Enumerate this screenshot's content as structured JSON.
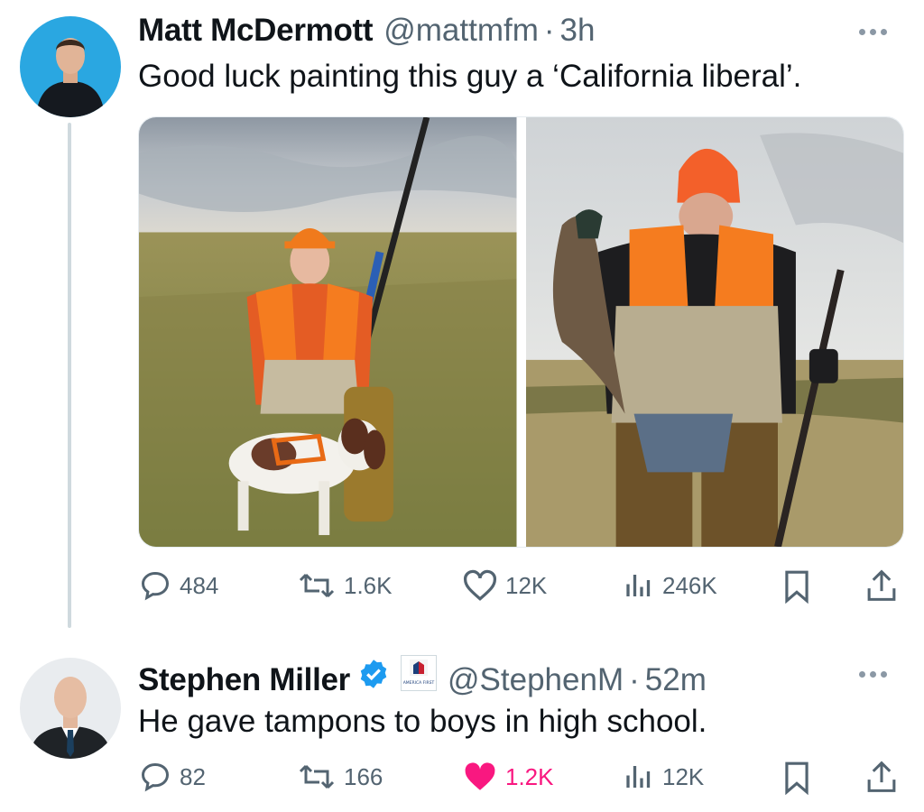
{
  "tweet1": {
    "name": "Matt McDermott",
    "handle": "@mattmfm",
    "separator": "·",
    "time": "3h",
    "text": "Good luck painting this guy a ‘California liberal’.",
    "stats": {
      "replies": "484",
      "reposts": "1.6K",
      "likes": "12K",
      "views": "246K"
    },
    "liked": false
  },
  "tweet2": {
    "name": "Stephen Miller",
    "badge_text": "AMERICA FIRST",
    "handle": "@StephenM",
    "separator": "·",
    "time": "52m",
    "text": "He gave tampons to boys in high school.",
    "stats": {
      "replies": "82",
      "reposts": "166",
      "likes": "1.2K",
      "views": "12K"
    },
    "liked": true
  },
  "colors": {
    "text_primary": "#0f1419",
    "text_secondary": "#536471",
    "like_active": "#f91880",
    "verified_blue": "#1d9bf0",
    "thread_line": "#cfd9de"
  },
  "icons": [
    "reply-icon",
    "repost-icon",
    "like-icon",
    "views-icon",
    "bookmark-icon",
    "share-icon",
    "more-icon",
    "verified-icon"
  ]
}
